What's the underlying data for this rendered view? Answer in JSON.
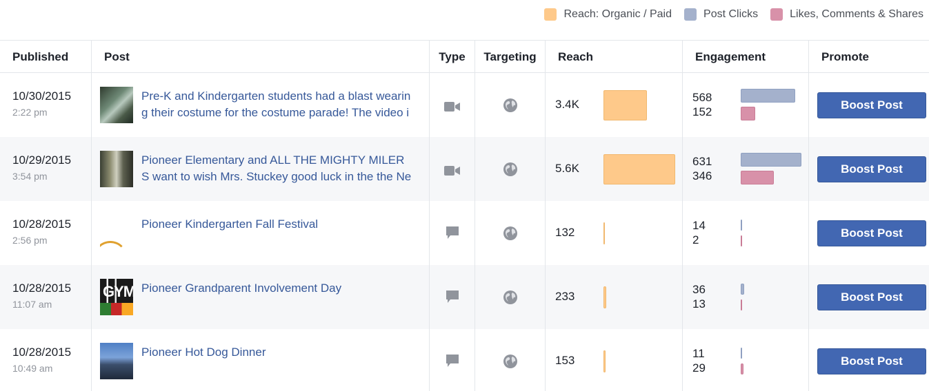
{
  "legend": {
    "items": [
      {
        "label": "Reach: Organic / Paid",
        "color": "#fec98a"
      },
      {
        "label": "Post Clicks",
        "color": "#a4b1cc"
      },
      {
        "label": "Likes, Comments & Shares",
        "color": "#d891a9"
      }
    ]
  },
  "table": {
    "headers": {
      "published": "Published",
      "post": "Post",
      "type": "Type",
      "targeting": "Targeting",
      "reach": "Reach",
      "engagement": "Engagement",
      "promote": "Promote"
    },
    "rows": [
      {
        "date": "10/30/2015",
        "time": "2:22 pm",
        "text": "Pre-K and Kindergarten students had a blast wearin\ng their costume for the costume parade! The video i",
        "type_icon": "video-icon",
        "targeting_icon": "globe-icon",
        "reach": "3.4K",
        "reach_value": 3400,
        "post_clicks": "568",
        "post_clicks_value": 568,
        "likes_comments_shares": "152",
        "likes_comments_shares_value": 152,
        "boost_label": "Boost Post"
      },
      {
        "date": "10/29/2015",
        "time": "3:54 pm",
        "text": "Pioneer Elementary and ALL THE MIGHTY MILER\nS want to wish Mrs. Stuckey good luck in the the Ne",
        "type_icon": "video-icon",
        "targeting_icon": "globe-icon",
        "reach": "5.6K",
        "reach_value": 5600,
        "post_clicks": "631",
        "post_clicks_value": 631,
        "likes_comments_shares": "346",
        "likes_comments_shares_value": 346,
        "boost_label": "Boost Post"
      },
      {
        "date": "10/28/2015",
        "time": "2:56 pm",
        "text": "Pioneer Kindergarten Fall Festival",
        "type_icon": "status-icon",
        "targeting_icon": "globe-icon",
        "reach": "132",
        "reach_value": 132,
        "post_clicks": "14",
        "post_clicks_value": 14,
        "likes_comments_shares": "2",
        "likes_comments_shares_value": 2,
        "boost_label": "Boost Post"
      },
      {
        "date": "10/28/2015",
        "time": "11:07 am",
        "text": "Pioneer Grandparent Involvement Day",
        "type_icon": "status-icon",
        "targeting_icon": "globe-icon",
        "reach": "233",
        "reach_value": 233,
        "post_clicks": "36",
        "post_clicks_value": 36,
        "likes_comments_shares": "13",
        "likes_comments_shares_value": 13,
        "boost_label": "Boost Post"
      },
      {
        "date": "10/28/2015",
        "time": "10:49 am",
        "text": "Pioneer Hot Dog Dinner",
        "type_icon": "status-icon",
        "targeting_icon": "globe-icon",
        "reach": "153",
        "reach_value": 153,
        "post_clicks": "11",
        "post_clicks_value": 11,
        "likes_comments_shares": "29",
        "likes_comments_shares_value": 29,
        "boost_label": "Boost Post"
      }
    ]
  }
}
